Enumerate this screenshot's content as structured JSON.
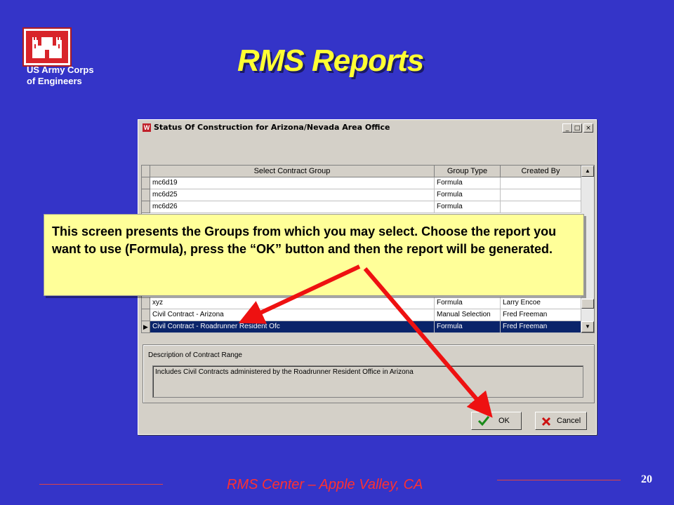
{
  "org": {
    "line1": "US Army Corps",
    "line2": "of Engineers"
  },
  "slide_title": "RMS Reports",
  "window": {
    "title": "Status Of Construction for Arizona/Nevada Area Office",
    "minimize": "_",
    "maximize": "□",
    "close": "×"
  },
  "grid": {
    "headers": [
      "Select Contract Group",
      "Group Type",
      "Created By"
    ],
    "top_rows": [
      {
        "name": "mc6d19",
        "type": "Formula",
        "by": ""
      },
      {
        "name": "mc6d25",
        "type": "Formula",
        "by": ""
      },
      {
        "name": "mc6d26",
        "type": "Formula",
        "by": ""
      }
    ],
    "bottom_rows": [
      {
        "name": "xyz",
        "type": "Formula",
        "by": "Larry Encoe"
      },
      {
        "name": "Civil Contract - Arizona",
        "type": "Manual Selection",
        "by": "Fred Freeman"
      },
      {
        "name": "Civil Contract - Roadrunner Resident Ofc",
        "type": "Formula",
        "by": "Fred Freeman"
      }
    ]
  },
  "description": {
    "label": "Description of Contract Range",
    "text": "Includes Civil Contracts administered by the Roadrunner Resident Office in Arizona"
  },
  "buttons": {
    "ok": "OK",
    "cancel": "Cancel"
  },
  "callout": "This screen presents the Groups from which you may select. Choose the report you want to use (Formula), press the “OK” button and then the report will be generated.",
  "footer": {
    "text": "RMS Center – Apple Valley, CA",
    "page": "20"
  },
  "colors": {
    "background": "#3434c8",
    "title": "#ffff33",
    "callout": "#ffff99",
    "arrow": "#ee1111",
    "selection": "#0a246a"
  }
}
